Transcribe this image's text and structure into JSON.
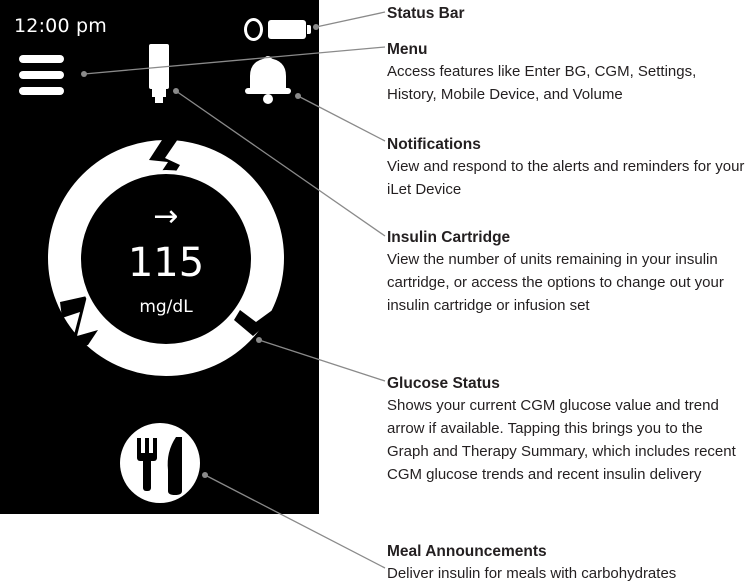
{
  "device": {
    "status_time": "12:00 pm",
    "glucose_value": "115",
    "glucose_unit": "mg/dL",
    "trend_arrow": "→",
    "trend_icon": "arrow-right-icon"
  },
  "annotations": [
    {
      "title": "Status Bar",
      "desc": ""
    },
    {
      "title": "Menu",
      "desc": "Access features like Enter BG, CGM, Settings, History, Mobile Device, and Volume"
    },
    {
      "title": "Notifications",
      "desc": "View and respond to the alerts and reminders for your iLet Device"
    },
    {
      "title": "Insulin Cartridge",
      "desc": "View the number of units remaining in your insulin cartridge, or access the options to change out your insulin cartridge or infusion set"
    },
    {
      "title": "Glucose Status",
      "desc": "Shows your current CGM glucose value and trend arrow if available. Tapping this brings you to the Graph and Therapy Summary, which includes recent CGM glucose trends and recent insulin delivery"
    },
    {
      "title": "Meal Announcements",
      "desc": "Deliver insulin for meals with carbohydrates"
    }
  ],
  "colors": {
    "screen": "#000000",
    "foreground": "#ffffff",
    "text": "#231f20",
    "leader_line": "#8a8a8a"
  }
}
